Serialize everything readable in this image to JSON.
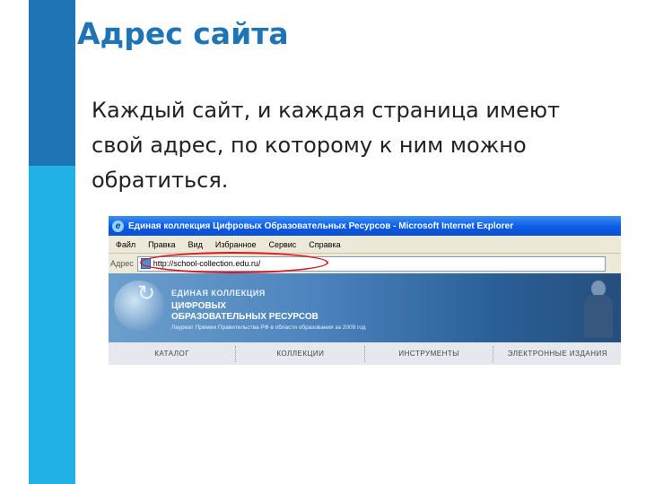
{
  "slide": {
    "title": "Адрес сайта",
    "body": "Каждый сайт, и каждая страница имеют свой адрес, по которому к ним можно обратиться."
  },
  "browser": {
    "window_title": "Единая коллекция Цифровых Образовательных Ресурсов - Microsoft Internet Explorer",
    "menu": [
      "Файл",
      "Правка",
      "Вид",
      "Избранное",
      "Сервис",
      "Справка"
    ],
    "address_label": "Адрес",
    "address_value": "http://school-collection.edu.ru/",
    "highlight_color": "#e2151c"
  },
  "site": {
    "brand_line1": "ЕДИНАЯ КОЛЛЕКЦИЯ",
    "brand_line2": "ЦИФРОВЫХ",
    "brand_line3": "ОБРАЗОВАТЕЛЬНЫХ РЕСУРСОВ",
    "tagline": "Лауреат Премии Правительства РФ в области образования за 2009 год",
    "nav": [
      "КАТАЛОГ",
      "КОЛЛЕКЦИИ",
      "ИНСТРУМЕНТЫ",
      "ЭЛЕКТРОННЫЕ ИЗДАНИЯ"
    ]
  },
  "colors": {
    "accent_dark": "#1f74b6",
    "accent_light": "#21b1e6"
  }
}
